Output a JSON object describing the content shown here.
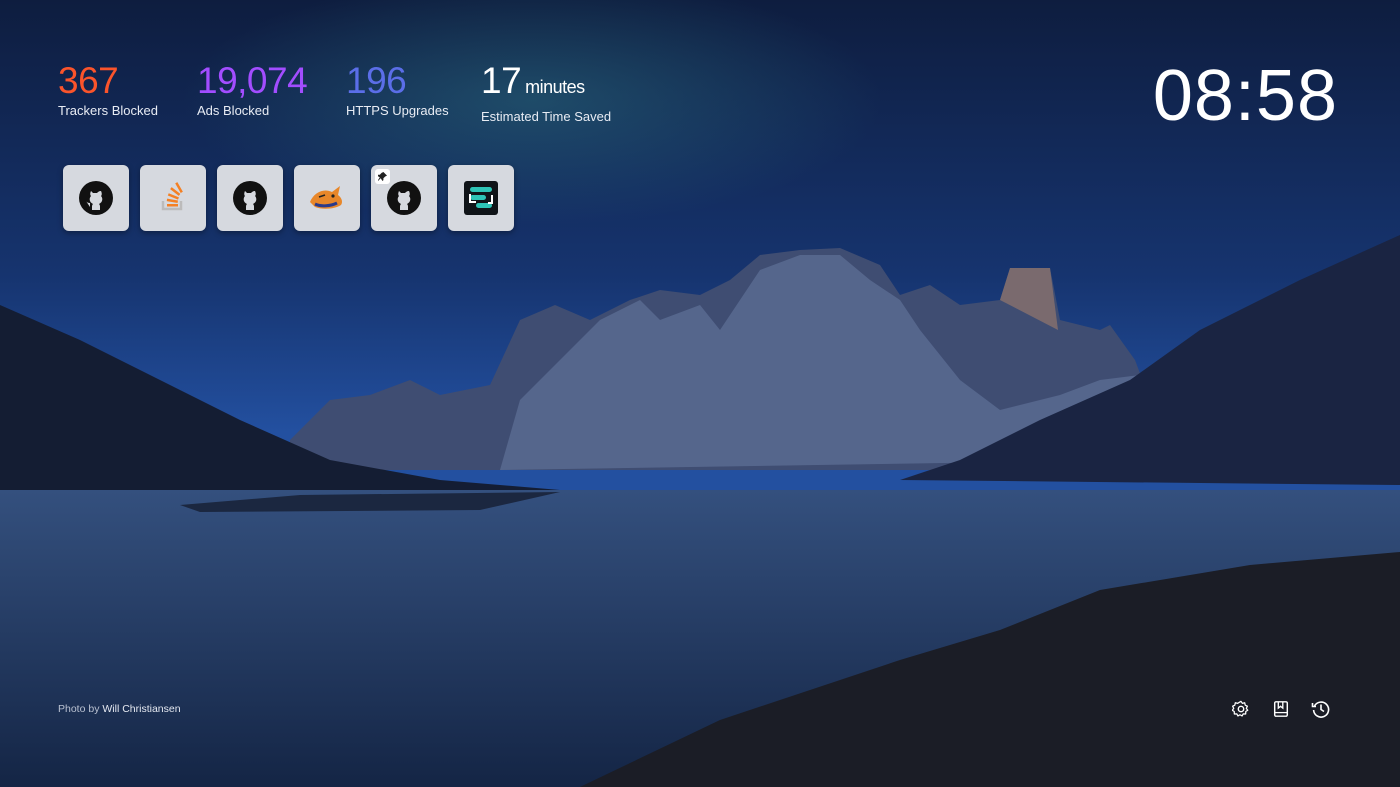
{
  "stats": [
    {
      "value": "367",
      "unit": "",
      "label": "Trackers Blocked",
      "color": "#fb542b"
    },
    {
      "value": "19,074",
      "unit": "",
      "label": "Ads Blocked",
      "color": "#a24dff"
    },
    {
      "value": "196",
      "unit": "",
      "label": "HTTPS Upgrades",
      "color": "#5b6ee8"
    },
    {
      "value": "17",
      "unit": "minutes",
      "label": "Estimated Time Saved",
      "color": "#ffffff"
    }
  ],
  "clock": {
    "time": "08:58"
  },
  "top_sites": [
    {
      "icon": "github-icon",
      "pinned": false
    },
    {
      "icon": "stackoverflow-icon",
      "pinned": false
    },
    {
      "icon": "github-icon",
      "pinned": false
    },
    {
      "icon": "fox-logo-icon",
      "pinned": false
    },
    {
      "icon": "github-icon",
      "pinned": true
    },
    {
      "icon": "s-logo-icon",
      "pinned": false
    }
  ],
  "photo_credit": {
    "prefix": "Photo by",
    "author": "Will Christiansen"
  },
  "footer_actions": [
    {
      "icon": "settings-gear-icon"
    },
    {
      "icon": "bookmarks-icon"
    },
    {
      "icon": "history-icon"
    }
  ]
}
